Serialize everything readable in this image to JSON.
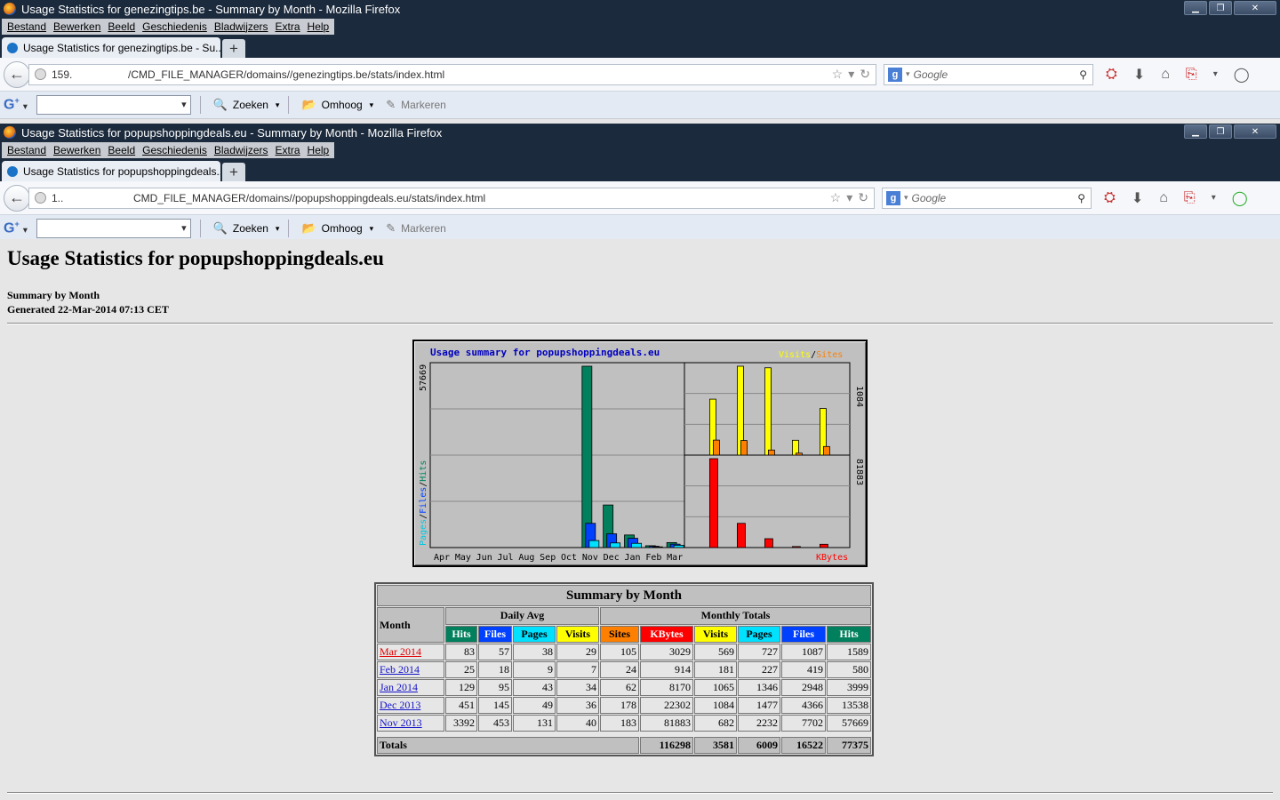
{
  "window1": {
    "title": "Usage Statistics for genezingtips.be - Summary by Month - Mozilla Firefox",
    "menu": [
      "Bestand",
      "Bewerken",
      "Beeld",
      "Geschiedenis",
      "Bladwijzers",
      "Extra",
      "Help"
    ],
    "tab": "Usage Statistics for genezingtips.be - Su...",
    "url_prefix": "159.",
    "url_rest": "/CMD_FILE_MANAGER/domains//genezingtips.be/stats/index.html",
    "search_placeholder": "Google",
    "toolbar": {
      "search": "Zoeken",
      "up": "Omhoog",
      "mark": "Markeren"
    }
  },
  "window2": {
    "title": "Usage Statistics for popupshoppingdeals.eu - Summary by Month - Mozilla Firefox",
    "menu": [
      "Bestand",
      "Bewerken",
      "Beeld",
      "Geschiedenis",
      "Bladwijzers",
      "Extra",
      "Help"
    ],
    "tab": "Usage Statistics for popupshoppingdeals....",
    "url_prefix": "1..",
    "url_rest": "CMD_FILE_MANAGER/domains//popupshoppingdeals.eu/stats/index.html",
    "search_placeholder": "Google",
    "toolbar": {
      "search": "Zoeken",
      "up": "Omhoog",
      "mark": "Markeren"
    }
  },
  "page": {
    "heading": "Usage Statistics for popupshoppingdeals.eu",
    "summary_label": "Summary by Month",
    "generated": "Generated 22-Mar-2014 07:13 CET"
  },
  "chart_data": {
    "type": "bar",
    "title": "Usage summary for popupshoppingdeals.eu",
    "categories": [
      "Apr",
      "May",
      "Jun",
      "Jul",
      "Aug",
      "Sep",
      "Oct",
      "Nov",
      "Dec",
      "Jan",
      "Feb",
      "Mar"
    ],
    "series": [
      {
        "name": "Hits",
        "color": "#00805c",
        "values": [
          0,
          0,
          0,
          0,
          0,
          0,
          0,
          57669,
          13538,
          3999,
          580,
          1589
        ]
      },
      {
        "name": "Files",
        "color": "#0040ff",
        "values": [
          0,
          0,
          0,
          0,
          0,
          0,
          0,
          7702,
          4366,
          2948,
          419,
          1087
        ]
      },
      {
        "name": "Pages",
        "color": "#00e0ff",
        "values": [
          0,
          0,
          0,
          0,
          0,
          0,
          0,
          2232,
          1477,
          1346,
          227,
          727
        ]
      }
    ],
    "right_top": {
      "label_a": "Visits",
      "label_b": "Sites",
      "max": "1084",
      "visits": [
        682,
        1084,
        1065,
        181,
        569
      ],
      "sites": [
        183,
        178,
        62,
        24,
        105
      ]
    },
    "right_bottom": {
      "label": "KBytes",
      "max": "81883",
      "values": [
        81883,
        22302,
        8170,
        914,
        3029
      ]
    },
    "left_max": "57669",
    "left_axis_label": {
      "a": "Pages",
      "b": "Files",
      "c": "Hits"
    }
  },
  "table": {
    "title": "Summary by Month",
    "month_header": "Month",
    "daily_avg": "Daily Avg",
    "monthly_totals": "Monthly Totals",
    "cols": [
      {
        "label": "Hits",
        "bg": "#00805c"
      },
      {
        "label": "Files",
        "bg": "#0040ff"
      },
      {
        "label": "Pages",
        "bg": "#00e0ff"
      },
      {
        "label": "Visits",
        "bg": "#ffff00"
      },
      {
        "label": "Sites",
        "bg": "#ff8000"
      },
      {
        "label": "KBytes",
        "bg": "#ff0000"
      },
      {
        "label": "Visits",
        "bg": "#ffff00"
      },
      {
        "label": "Pages",
        "bg": "#00e0ff"
      },
      {
        "label": "Files",
        "bg": "#0040ff"
      },
      {
        "label": "Hits",
        "bg": "#00805c"
      }
    ],
    "rows": [
      {
        "month": "Mar 2014",
        "current": true,
        "vals": [
          "83",
          "57",
          "38",
          "29",
          "105",
          "3029",
          "569",
          "727",
          "1087",
          "1589"
        ]
      },
      {
        "month": "Feb 2014",
        "current": false,
        "vals": [
          "25",
          "18",
          "9",
          "7",
          "24",
          "914",
          "181",
          "227",
          "419",
          "580"
        ]
      },
      {
        "month": "Jan 2014",
        "current": false,
        "vals": [
          "129",
          "95",
          "43",
          "34",
          "62",
          "8170",
          "1065",
          "1346",
          "2948",
          "3999"
        ]
      },
      {
        "month": "Dec 2013",
        "current": false,
        "vals": [
          "451",
          "145",
          "49",
          "36",
          "178",
          "22302",
          "1084",
          "1477",
          "4366",
          "13538"
        ]
      },
      {
        "month": "Nov 2013",
        "current": false,
        "vals": [
          "3392",
          "453",
          "131",
          "40",
          "183",
          "81883",
          "682",
          "2232",
          "7702",
          "57669"
        ]
      }
    ],
    "totals_label": "Totals",
    "totals": [
      "116298",
      "3581",
      "6009",
      "16522",
      "77375"
    ]
  }
}
